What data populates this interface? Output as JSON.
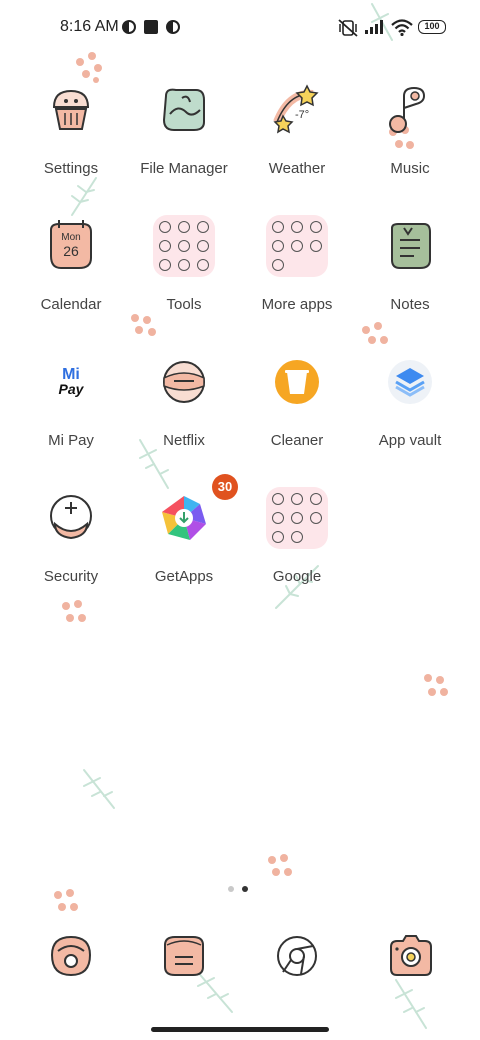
{
  "status": {
    "time": "8:16 AM",
    "battery": "100",
    "icons": [
      "app-notification-icon",
      "stop-square-icon",
      "app-notification-icon",
      "vibrate-silent-icon",
      "signal-icon",
      "wifi-icon",
      "battery-icon"
    ]
  },
  "apps": [
    {
      "label": "Settings",
      "icon": "cupcake-settings-icon"
    },
    {
      "label": "File Manager",
      "icon": "file-manager-icon"
    },
    {
      "label": "Weather",
      "icon": "shooting-star-weather-icon",
      "temp": "-7°"
    },
    {
      "label": "Music",
      "icon": "music-note-icon"
    },
    {
      "label": "Calendar",
      "icon": "calendar-icon",
      "month": "Mon",
      "day": "26"
    },
    {
      "label": "Tools",
      "icon": "folder-icon"
    },
    {
      "label": "More apps",
      "icon": "folder-icon"
    },
    {
      "label": "Notes",
      "icon": "notes-icon"
    },
    {
      "label": "Mi Pay",
      "icon": "mi-pay-icon",
      "logo_top": "Mi",
      "logo_bottom": "Pay"
    },
    {
      "label": "Netflix",
      "icon": "netflix-icon"
    },
    {
      "label": "Cleaner",
      "icon": "cleaner-icon"
    },
    {
      "label": "App vault",
      "icon": "app-vault-icon"
    },
    {
      "label": "Security",
      "icon": "security-icon"
    },
    {
      "label": "GetApps",
      "icon": "getapps-icon",
      "badge": "30"
    },
    {
      "label": "Google",
      "icon": "folder-icon"
    }
  ],
  "dock": [
    {
      "icon": "phone-icon"
    },
    {
      "icon": "messages-icon"
    },
    {
      "icon": "chrome-browser-icon"
    },
    {
      "icon": "camera-icon"
    }
  ],
  "pager": {
    "pages": 2,
    "active": 2
  },
  "colors": {
    "accent": "#f3b9a4",
    "mint": "#bfdccc",
    "folder": "#fde6ea",
    "badge": "#e0521f",
    "cleaner": "#f6a623"
  }
}
